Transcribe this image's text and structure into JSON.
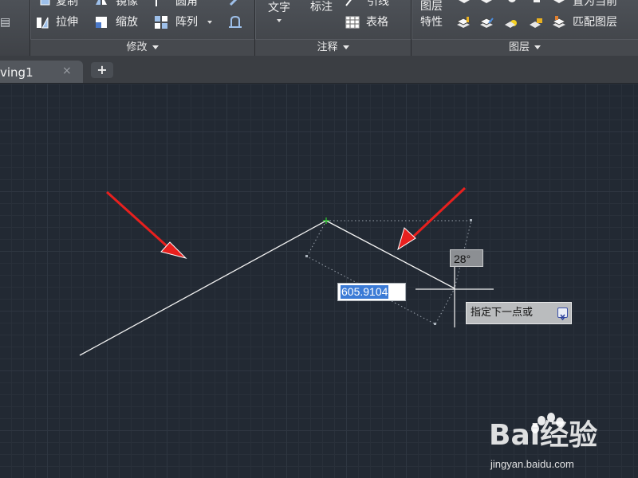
{
  "ribbon": {
    "modify_panel": {
      "title": "修改",
      "row_top": [
        "复制",
        "镜像",
        "圆角"
      ],
      "stretch": "拉伸",
      "scale": "缩放",
      "array": "阵列"
    },
    "annotation_panel": {
      "title": "注释",
      "text": "文字",
      "dimension": "标注",
      "leader": "引线",
      "table": "表格"
    },
    "layers_panel": {
      "title": "图层",
      "layer_props_line1": "图层",
      "layer_props_line2": "特性",
      "set_current": "置为当前",
      "match_layer": "匹配图层"
    }
  },
  "tabs": {
    "drawing_label": "ving1",
    "close_glyph": "×",
    "new_tab_glyph": "+"
  },
  "canvas": {
    "angle_readout": "28°",
    "length_input": "605.9104",
    "prompt": "指定下一点或",
    "line_color": "#ffffff",
    "arrow_color": "#e8201e",
    "snap_marker_color": "#2fd12f"
  },
  "watermark": {
    "brand": "Bai经验",
    "url": "jingyan.baidu.com"
  }
}
